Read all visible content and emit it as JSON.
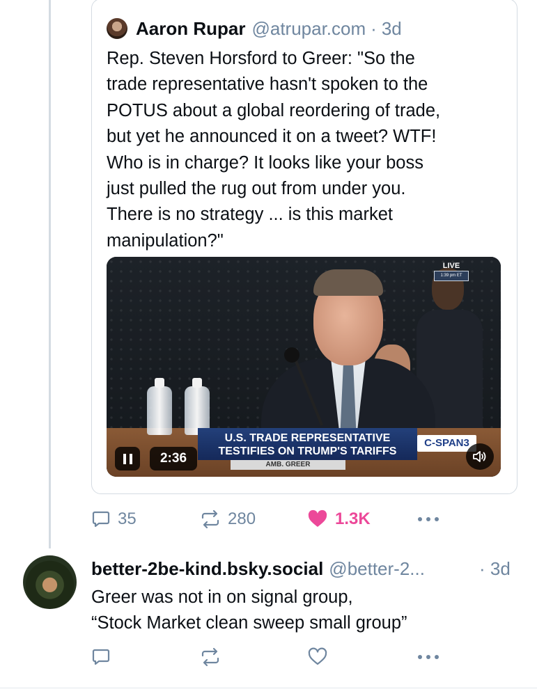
{
  "quote": {
    "author_name": "Aaron Rupar",
    "author_handle": "@atrupar.com",
    "separator": "·",
    "time": "3d",
    "text": "Rep. Steven Horsford to Greer: \"So the\ntrade representative hasn't spoken to the\nPOTUS about a global reordering of trade,\nbut yet he announced it on a tweet? WTF!\nWho is in charge? It looks like your boss\njust pulled the rug out from under you.\nThere is no strategy ... is this market\nmanipulation?\"",
    "video": {
      "live_label": "LIVE",
      "live_time": "1:39 pm ET",
      "lower_third_line1": "U.S. TRADE REPRESENTATIVE",
      "lower_third_line2": "TESTIFIES ON TRUMP'S TARIFFS",
      "network": "C-SPAN3",
      "nameplate": "AMB. GREER",
      "elapsed": "2:36"
    }
  },
  "actions": {
    "replies": "35",
    "reposts": "280",
    "likes": "1.3K",
    "liked": true,
    "like_color": "#ec4899"
  },
  "reply": {
    "author_name": "better-2be-kind.bsky.social",
    "author_handle": "@better-2...",
    "time": "· 3d",
    "text": "Greer was not in on signal group,\n“Stock Market clean sweep small group”"
  },
  "colors": {
    "muted": "#6f869f",
    "border": "#d4dbe2",
    "like": "#ec4899"
  }
}
